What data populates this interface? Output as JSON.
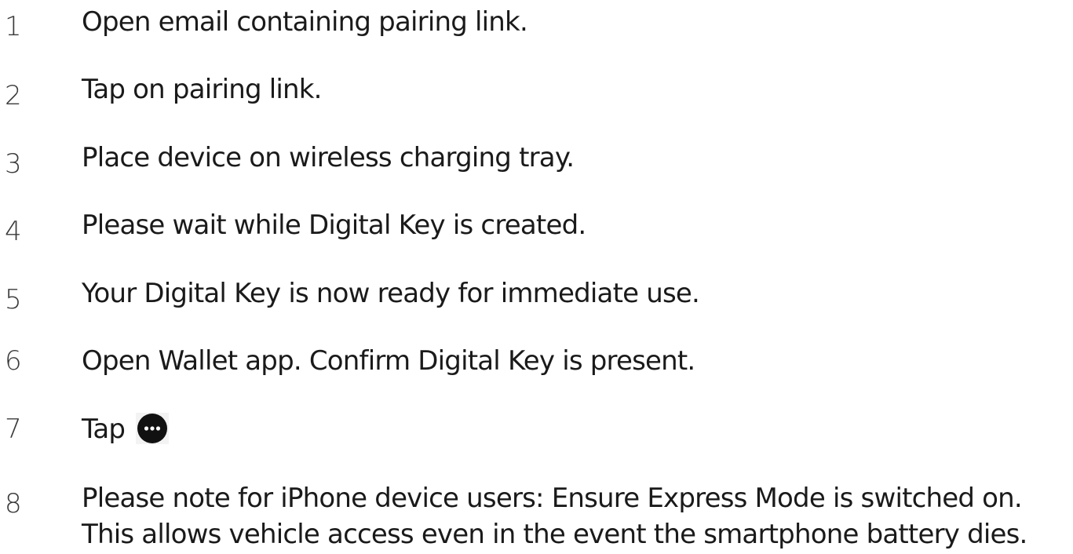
{
  "steps": [
    {
      "number": "1",
      "text": "Open email containing pairing link."
    },
    {
      "number": "2",
      "text": "Tap on pairing link."
    },
    {
      "number": "3",
      "text": "Place device on wireless charging tray."
    },
    {
      "number": "4",
      "text": "Please wait while Digital Key is created."
    },
    {
      "number": "5",
      "text": "Your Digital Key is now ready for immediate use."
    },
    {
      "number": "6",
      "text": "Open Wallet app. Confirm Digital Key is present."
    },
    {
      "number": "7",
      "text": "Tap",
      "icon": "more-icon"
    },
    {
      "number": "8",
      "line1": "Please note for iPhone device users: Ensure Express Mode is switched on.",
      "line2": "This allows vehicle access even in the event the smartphone battery dies."
    }
  ],
  "colors": {
    "text": "#1a1a1a",
    "number": "#3a3a3a",
    "icon_bg": "#111111",
    "icon_dots": "#ffffff"
  }
}
